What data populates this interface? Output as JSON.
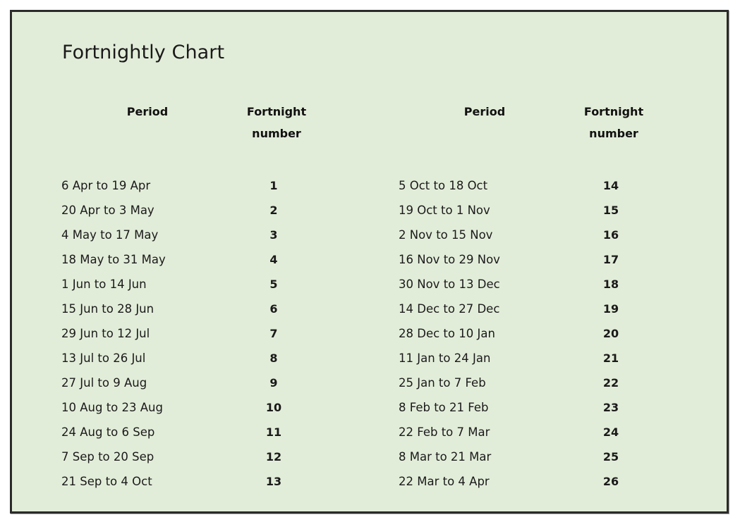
{
  "document": {
    "title": "Fortnightly Chart",
    "background_color": "#E2EDD9",
    "border_color": "#2B2B2B",
    "text_color": "#1a1a1a"
  },
  "headers": {
    "period": "Period",
    "fortnight_number": "Fortnight\nnumber"
  },
  "chart_data": {
    "type": "table",
    "title": "Fortnightly Chart",
    "columns": [
      "Period",
      "Fortnight number",
      "Period",
      "Fortnight number"
    ],
    "left_rows": [
      {
        "period": "6 Apr to 19 Apr",
        "number": "1"
      },
      {
        "period": "20 Apr to 3 May",
        "number": "2"
      },
      {
        "period": "4 May to 17 May",
        "number": "3"
      },
      {
        "period": "18 May to 31 May",
        "number": "4"
      },
      {
        "period": "1 Jun to 14 Jun",
        "number": "5"
      },
      {
        "period": "15 Jun to 28 Jun",
        "number": "6"
      },
      {
        "period": "29 Jun to 12 Jul",
        "number": "7"
      },
      {
        "period": "13 Jul to 26 Jul",
        "number": "8"
      },
      {
        "period": "27 Jul to 9 Aug",
        "number": "9"
      },
      {
        "period": "10 Aug to 23 Aug",
        "number": "10"
      },
      {
        "period": "24 Aug to 6 Sep",
        "number": "11"
      },
      {
        "period": "7 Sep to 20 Sep",
        "number": "12"
      },
      {
        "period": "21 Sep to 4 Oct",
        "number": "13"
      }
    ],
    "right_rows": [
      {
        "period": "5 Oct to 18 Oct",
        "number": "14"
      },
      {
        "period": "19 Oct to 1 Nov",
        "number": "15"
      },
      {
        "period": "2 Nov to 15 Nov",
        "number": "16"
      },
      {
        "period": "16 Nov to 29 Nov",
        "number": "17"
      },
      {
        "period": "30 Nov to 13 Dec",
        "number": "18"
      },
      {
        "period": "14 Dec to 27 Dec",
        "number": "19"
      },
      {
        "period": "28 Dec to 10 Jan",
        "number": "20"
      },
      {
        "period": "11 Jan to 24 Jan",
        "number": "21"
      },
      {
        "period": "25 Jan to 7 Feb",
        "number": "22"
      },
      {
        "period": "8 Feb to 21 Feb",
        "number": "23"
      },
      {
        "period": "22 Feb to 7 Mar",
        "number": "24"
      },
      {
        "period": "8 Mar to 21 Mar",
        "number": "25"
      },
      {
        "period": "22 Mar to 4 Apr",
        "number": "26"
      }
    ]
  }
}
